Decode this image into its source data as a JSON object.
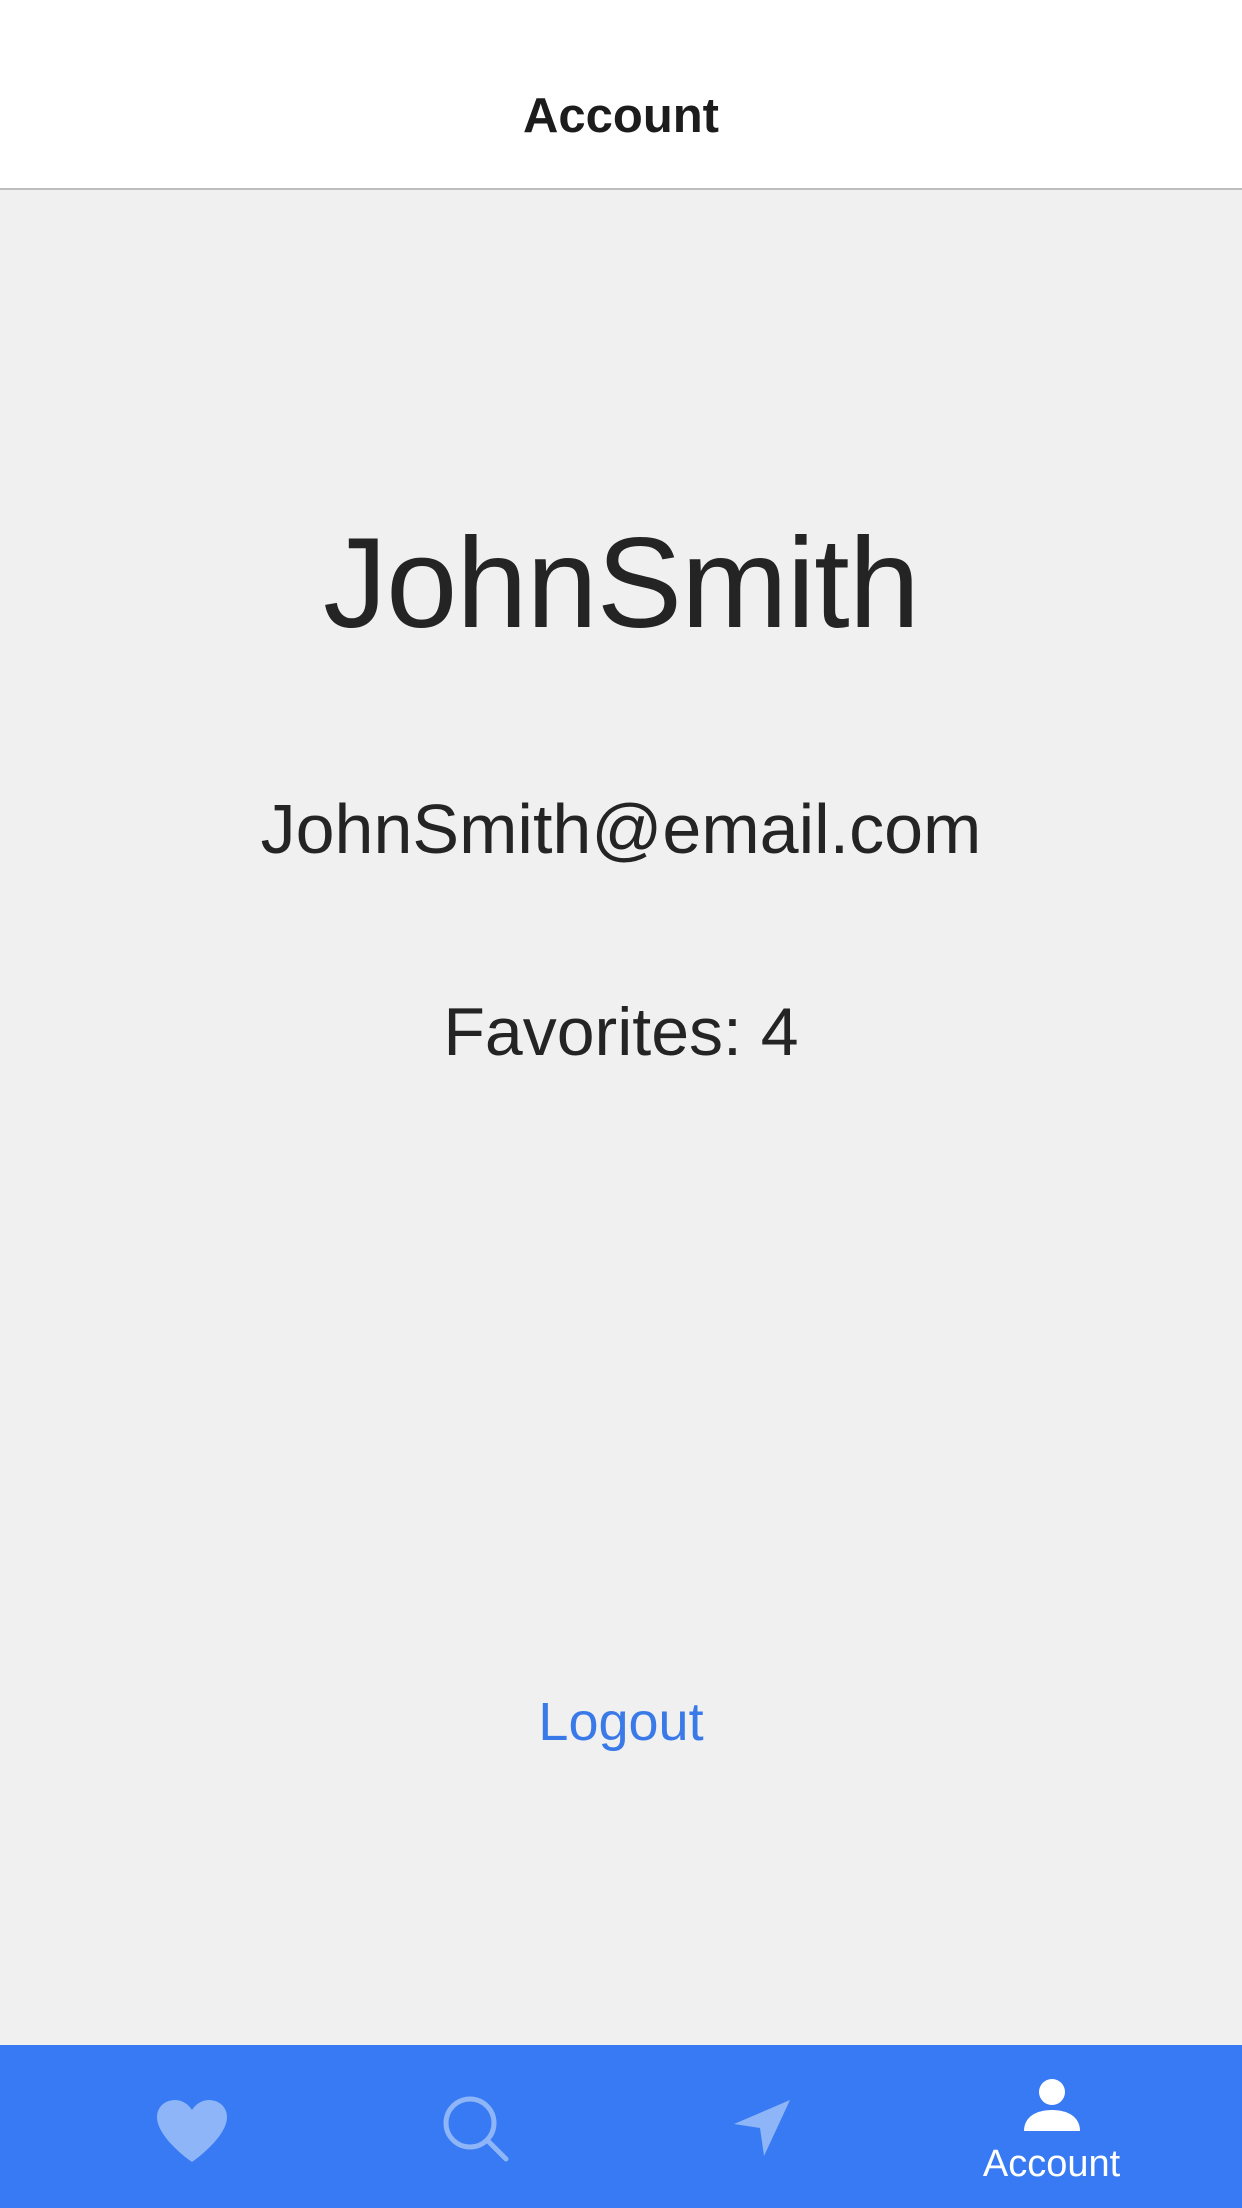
{
  "header": {
    "title": "Account"
  },
  "profile": {
    "username": "JohnSmith",
    "email": "JohnSmith@email.com",
    "favorites": "Favorites: 4"
  },
  "actions": {
    "logout_label": "Logout"
  },
  "tab_bar": {
    "tabs": [
      {
        "icon": "heart-icon",
        "label": "",
        "active": false
      },
      {
        "icon": "search-icon",
        "label": "",
        "active": false
      },
      {
        "icon": "location-arrow-icon",
        "label": "",
        "active": false
      },
      {
        "icon": "person-icon",
        "label": "Account",
        "active": true
      }
    ]
  },
  "colors": {
    "accent": "#387af3",
    "link": "#3a7ae8",
    "inactive_icon": "#8db5f7",
    "active_icon": "#ffffff",
    "background": "#f0f0f0",
    "header_background": "#ffffff",
    "text": "#242424"
  }
}
